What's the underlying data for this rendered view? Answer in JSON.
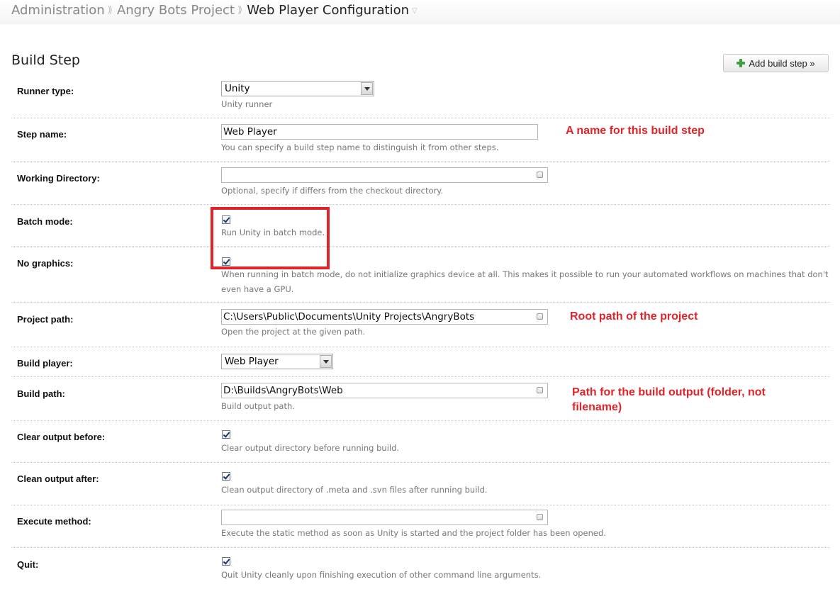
{
  "breadcrumb": {
    "items": [
      "Administration",
      "Angry Bots Project",
      "Web Player Configuration"
    ]
  },
  "section": {
    "title": "Build Step",
    "add_button": "Add build step »"
  },
  "rows": {
    "runner_type": {
      "label": "Runner type:",
      "value": "Unity",
      "note": "Unity runner"
    },
    "step_name": {
      "label": "Step name:",
      "value": "Web Player",
      "note": "You can specify a build step name to distinguish it from other steps."
    },
    "working_directory": {
      "label": "Working Directory:",
      "value": "",
      "note": "Optional, specify if differs from the checkout directory."
    },
    "batch_mode": {
      "label": "Batch mode:",
      "checked": true,
      "note": "Run Unity in batch mode."
    },
    "no_graphics": {
      "label": "No graphics:",
      "checked": true,
      "note_line1": "When running in batch mode, do not initialize graphics device at all. This makes it possible to run your automated workflows on machines that don't",
      "note_line2": "even have a GPU."
    },
    "project_path": {
      "label": "Project path:",
      "value": "C:\\Users\\Public\\Documents\\Unity Projects\\AngryBots",
      "note": "Open the project at the given path."
    },
    "build_player": {
      "label": "Build player:",
      "value": "Web Player"
    },
    "build_path": {
      "label": "Build path:",
      "value": "D:\\Builds\\AngryBots\\Web",
      "note": "Build output path."
    },
    "clear_output_before": {
      "label": "Clear output before:",
      "checked": true,
      "note": "Clear output directory before running build."
    },
    "clean_output_after": {
      "label": "Clean output after:",
      "checked": true,
      "note": "Clean output directory of .meta and .svn files after running build."
    },
    "execute_method": {
      "label": "Execute method:",
      "value": "",
      "note": "Execute the static method as soon as Unity is started and the project folder has been opened."
    },
    "quit": {
      "label": "Quit:",
      "checked": true,
      "note": "Quit Unity cleanly upon finishing execution of other command line arguments."
    }
  },
  "annotations": {
    "step_name": "A name for this build step",
    "project_path": "Root path of the project",
    "build_path_line1": "Path for the build output (folder, not",
    "build_path_line2": "filename)"
  },
  "colors": {
    "annotation": "#e0242a",
    "note_text": "#777777",
    "add_icon": "#3aa33a"
  }
}
